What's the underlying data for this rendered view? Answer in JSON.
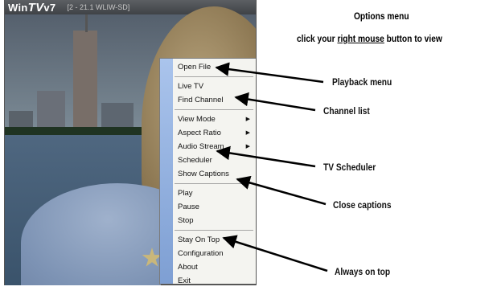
{
  "window": {
    "logo_prefix": "Win",
    "logo_tv": "TV",
    "logo_suffix": "v7",
    "channel_info": "[2 - 21.1   WLIW-SD]"
  },
  "menu": {
    "items": [
      {
        "label": "Open File",
        "submenu": false
      },
      {
        "label": "Live TV",
        "submenu": false
      },
      {
        "label": "Find Channel",
        "submenu": false
      },
      {
        "label": "View Mode",
        "submenu": true
      },
      {
        "label": "Aspect Ratio",
        "submenu": true
      },
      {
        "label": "Audio Stream",
        "submenu": true
      },
      {
        "label": "Scheduler",
        "submenu": false
      },
      {
        "label": "Show Captions",
        "submenu": false
      },
      {
        "label": "Play",
        "submenu": false
      },
      {
        "label": "Pause",
        "submenu": false
      },
      {
        "label": "Stop",
        "submenu": false
      },
      {
        "label": "Stay On Top",
        "submenu": false
      },
      {
        "label": "Configuration",
        "submenu": false
      },
      {
        "label": "About",
        "submenu": false
      },
      {
        "label": "Exit",
        "submenu": false
      }
    ]
  },
  "annotations": {
    "options_title": "Options menu",
    "instruction_prefix": "click your ",
    "instruction_link": "right mouse",
    "instruction_suffix": " button to view",
    "playback": "Playback menu",
    "channel_list": "Channel list",
    "tv_scheduler": "TV Scheduler",
    "close_captions": "Close captions",
    "always_on_top": "Always on top"
  },
  "colors": {
    "menu_stripe": "#7e9fd3",
    "menu_background": "#f4f4f0",
    "arrow": "#000000"
  }
}
